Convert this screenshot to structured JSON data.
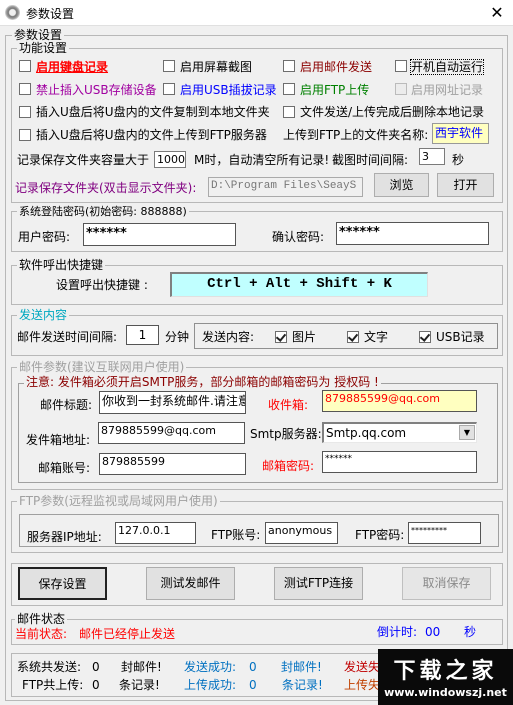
{
  "window": {
    "title": "参数设置",
    "close_icon": "close-icon"
  },
  "outer_group": {
    "label": "参数设置"
  },
  "features": {
    "label": "功能设置",
    "checkboxes": [
      {
        "label": "启用键盘记录",
        "checked": false,
        "color": "#ff0000"
      },
      {
        "label": "启用屏幕截图",
        "checked": false,
        "color": "#000000"
      },
      {
        "label": "启用邮件发送",
        "checked": false,
        "color": "#8b0000"
      },
      {
        "label": "开机自动运行",
        "checked": false,
        "color": "#000000"
      },
      {
        "label": "禁止插入USB存储设备",
        "checked": false,
        "color": "#a000a0"
      },
      {
        "label": "启用USB插拔记录",
        "checked": false,
        "color": "#0000ff"
      },
      {
        "label": "启用FTP上传",
        "checked": false,
        "color": "#008000"
      },
      {
        "label": "启用网址记录",
        "checked": false,
        "color": "#a0a0a0",
        "disabled": true
      },
      {
        "label": "插入U盘后将U盘内的文件复制到本地文件夹",
        "checked": false
      },
      {
        "label": "文件发送/上传完成后删除本地记录",
        "checked": false
      },
      {
        "label": "插入U盘后将U盘内的文件上传到FTP服务器",
        "checked": false
      }
    ],
    "ftp_folder_label": "上传到FTP上的文件夹名称:",
    "ftp_folder_value": "西宇软件",
    "capacity_prefix": "记录保存文件夹容量大于",
    "capacity_value": "1000",
    "capacity_suffix": "M时，自动清空所有记录!",
    "interval_label": "截图时间间隔:",
    "interval_value": "3",
    "interval_unit": "秒",
    "folder_label": "记录保存文件夹(双击显示文件夹):",
    "folder_path": "D:\\Program Files\\SeayS",
    "browse_label": "浏览",
    "open_label": "打开"
  },
  "login": {
    "label": "系统登陆密码(初始密码: 888888)",
    "user_pwd_label": "用户密码:",
    "user_pwd_value": "******",
    "confirm_pwd_label": "确认密码:",
    "confirm_pwd_value": "******"
  },
  "hotkey": {
    "label": "软件呼出快捷键",
    "set_label": "设置呼出快捷键 :",
    "value": "Ctrl + Alt + Shift + K"
  },
  "send": {
    "label": "发送内容",
    "interval_label": "邮件发送时间间隔:",
    "interval_value": "1",
    "interval_unit": "分钟",
    "content_label": "发送内容:",
    "options": [
      {
        "label": "图片",
        "checked": true
      },
      {
        "label": "文字",
        "checked": true
      },
      {
        "label": "USB记录",
        "checked": true
      }
    ]
  },
  "mail": {
    "label": "邮件参数(建议互联网用户使用)",
    "notice": "注意: 发件箱必须开启SMTP服务，部分邮箱的邮箱密码为 授权码 !",
    "subject_label": "邮件标题:",
    "subject_value": "你收到一封系统邮件.请注意",
    "recipient_label": "收件箱:",
    "recipient_value": "879885599@qq.com",
    "sender_label": "发件箱地址:",
    "sender_value": "879885599@qq.com",
    "smtp_label": "Smtp服务器:",
    "smtp_value": "Smtp.qq.com",
    "account_label": "邮箱账号:",
    "account_value": "879885599",
    "password_label": "邮箱密码:",
    "password_value": "******"
  },
  "ftp": {
    "label": "FTP参数(远程监视或局域网用户使用)",
    "ip_label": "服务器IP地址:",
    "ip_value": "127.0.0.1",
    "account_label": "FTP账号:",
    "account_value": "anonymous",
    "password_label": "FTP密码:",
    "password_value": "*********"
  },
  "buttons": {
    "save": "保存设置",
    "test_mail": "测试发邮件",
    "test_ftp": "测试FTP连接",
    "cancel": "取消保存"
  },
  "status": {
    "label": "邮件状态",
    "current_label": "当前状态:",
    "current_value": "邮件已经停止发送",
    "countdown_label": "倒计时:",
    "countdown_value": "00",
    "countdown_unit": "秒"
  },
  "stats": {
    "row1": {
      "total_label": "系统共发送:",
      "total_value": "0",
      "total_unit": "封邮件!",
      "ok_label": "发送成功:",
      "ok_value": "0",
      "ok_unit": "封邮件!",
      "fail_label": "发送失"
    },
    "row2": {
      "total_label": "FTP共上传:",
      "total_value": "0",
      "total_unit": "条记录!",
      "ok_label": "上传成功:",
      "ok_value": "0",
      "ok_unit": "条记录!",
      "fail_label": "上传失"
    }
  },
  "watermark": {
    "title": "下载之家",
    "url": "www.windowszj.net"
  }
}
